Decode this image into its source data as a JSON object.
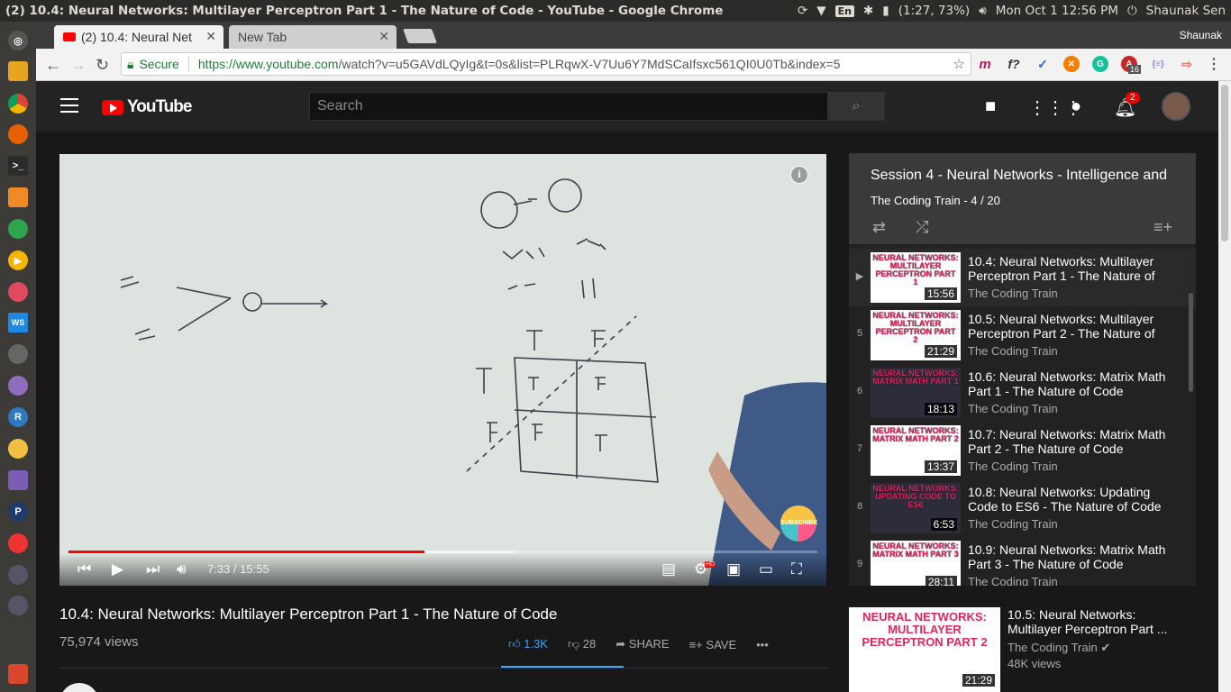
{
  "os_topbar": {
    "window_title": "(2) 10.4: Neural Networks: Multilayer Perceptron Part 1 - The Nature of Code - YouTube - Google Chrome",
    "keyboard": "En",
    "battery": "(1:27, 73%)",
    "clock": "Mon Oct  1 12:56 PM",
    "user": "Shaunak Sen"
  },
  "browser": {
    "tabs": [
      {
        "label": "(2) 10.4: Neural Net"
      },
      {
        "label": "New Tab"
      }
    ],
    "profile_name": "Shaunak",
    "secure_label": "Secure",
    "url_host": "https://www.youtube.com",
    "url_path": "/watch?v=u5GAVdLQyIg&t=0s&list=PLRqwX-V7Uu6Y7MdSCaIfsxc561QI0U0Tb&index=5",
    "extension_badge": "16"
  },
  "youtube": {
    "logo_text": "YouTube",
    "search_placeholder": "Search",
    "notification_count": "2"
  },
  "player": {
    "time_current": "7:33",
    "time_separator": " / ",
    "time_total": "15:55",
    "progress_fraction": 0.475,
    "buffered_fraction": 0.595,
    "watermark": "SUBSCRIBE",
    "info_glyph": "i",
    "hd_badge": "HD"
  },
  "video": {
    "title": "10.4: Neural Networks: Multilayer Perceptron Part 1 - The Nature of Code",
    "views": "75,974 views",
    "likes": "1.3K",
    "dislikes": "28",
    "share_label": "SHARE",
    "save_label": "SAVE"
  },
  "playlist": {
    "title": "Session 4 - Neural Networks - Intelligence and",
    "subtitle": "The Coding Train - 4 / 20",
    "items": [
      {
        "index": "▶",
        "thumb_text": "NEURAL NETWORKS: MULTILAYER PERCEPTRON PART 1",
        "duration": "15:56",
        "title": "10.4: Neural Networks: Multilayer Perceptron Part 1 - The Nature of",
        "channel": "The Coding Train"
      },
      {
        "index": "5",
        "thumb_text": "NEURAL NETWORKS: MULTILAYER PERCEPTRON PART 2",
        "duration": "21:29",
        "title": "10.5: Neural Networks: Multilayer Perceptron Part 2 - The Nature of",
        "channel": "The Coding Train"
      },
      {
        "index": "6",
        "thumb_text": "NEURAL NETWORKS: MATRIX MATH PART 1",
        "duration": "18:13",
        "title": "10.6: Neural Networks: Matrix Math Part 1 - The Nature of Code",
        "channel": "The Coding Train"
      },
      {
        "index": "7",
        "thumb_text": "NEURAL NETWORKS: MATRIX MATH PART 2",
        "duration": "13:37",
        "title": "10.7: Neural Networks: Matrix Math Part 2 - The Nature of Code",
        "channel": "The Coding Train"
      },
      {
        "index": "8",
        "thumb_text": "NEURAL NETWORKS: UPDATING CODE TO ES6",
        "duration": "6:53",
        "title": "10.8: Neural Networks: Updating Code to ES6 - The Nature of Code",
        "channel": "The Coding Train"
      },
      {
        "index": "9",
        "thumb_text": "NEURAL NETWORKS: MATRIX MATH PART 3",
        "duration": "28:11",
        "title": "10.9: Neural Networks: Matrix Math Part 3 - The Nature of Code",
        "channel": "The Coding Train"
      }
    ]
  },
  "up_next": {
    "thumb_text": "NEURAL NETWORKS: MULTILAYER PERCEPTRON PART 2",
    "duration": "21:29",
    "title": "10.5: Neural Networks: Multilayer Perceptron Part ...",
    "channel": "The Coding Train",
    "views": "48K views"
  },
  "colors": {
    "youtube_red": "#ff0000",
    "like_blue": "#3ea6ff",
    "thumb_pink": "#e0245e"
  }
}
